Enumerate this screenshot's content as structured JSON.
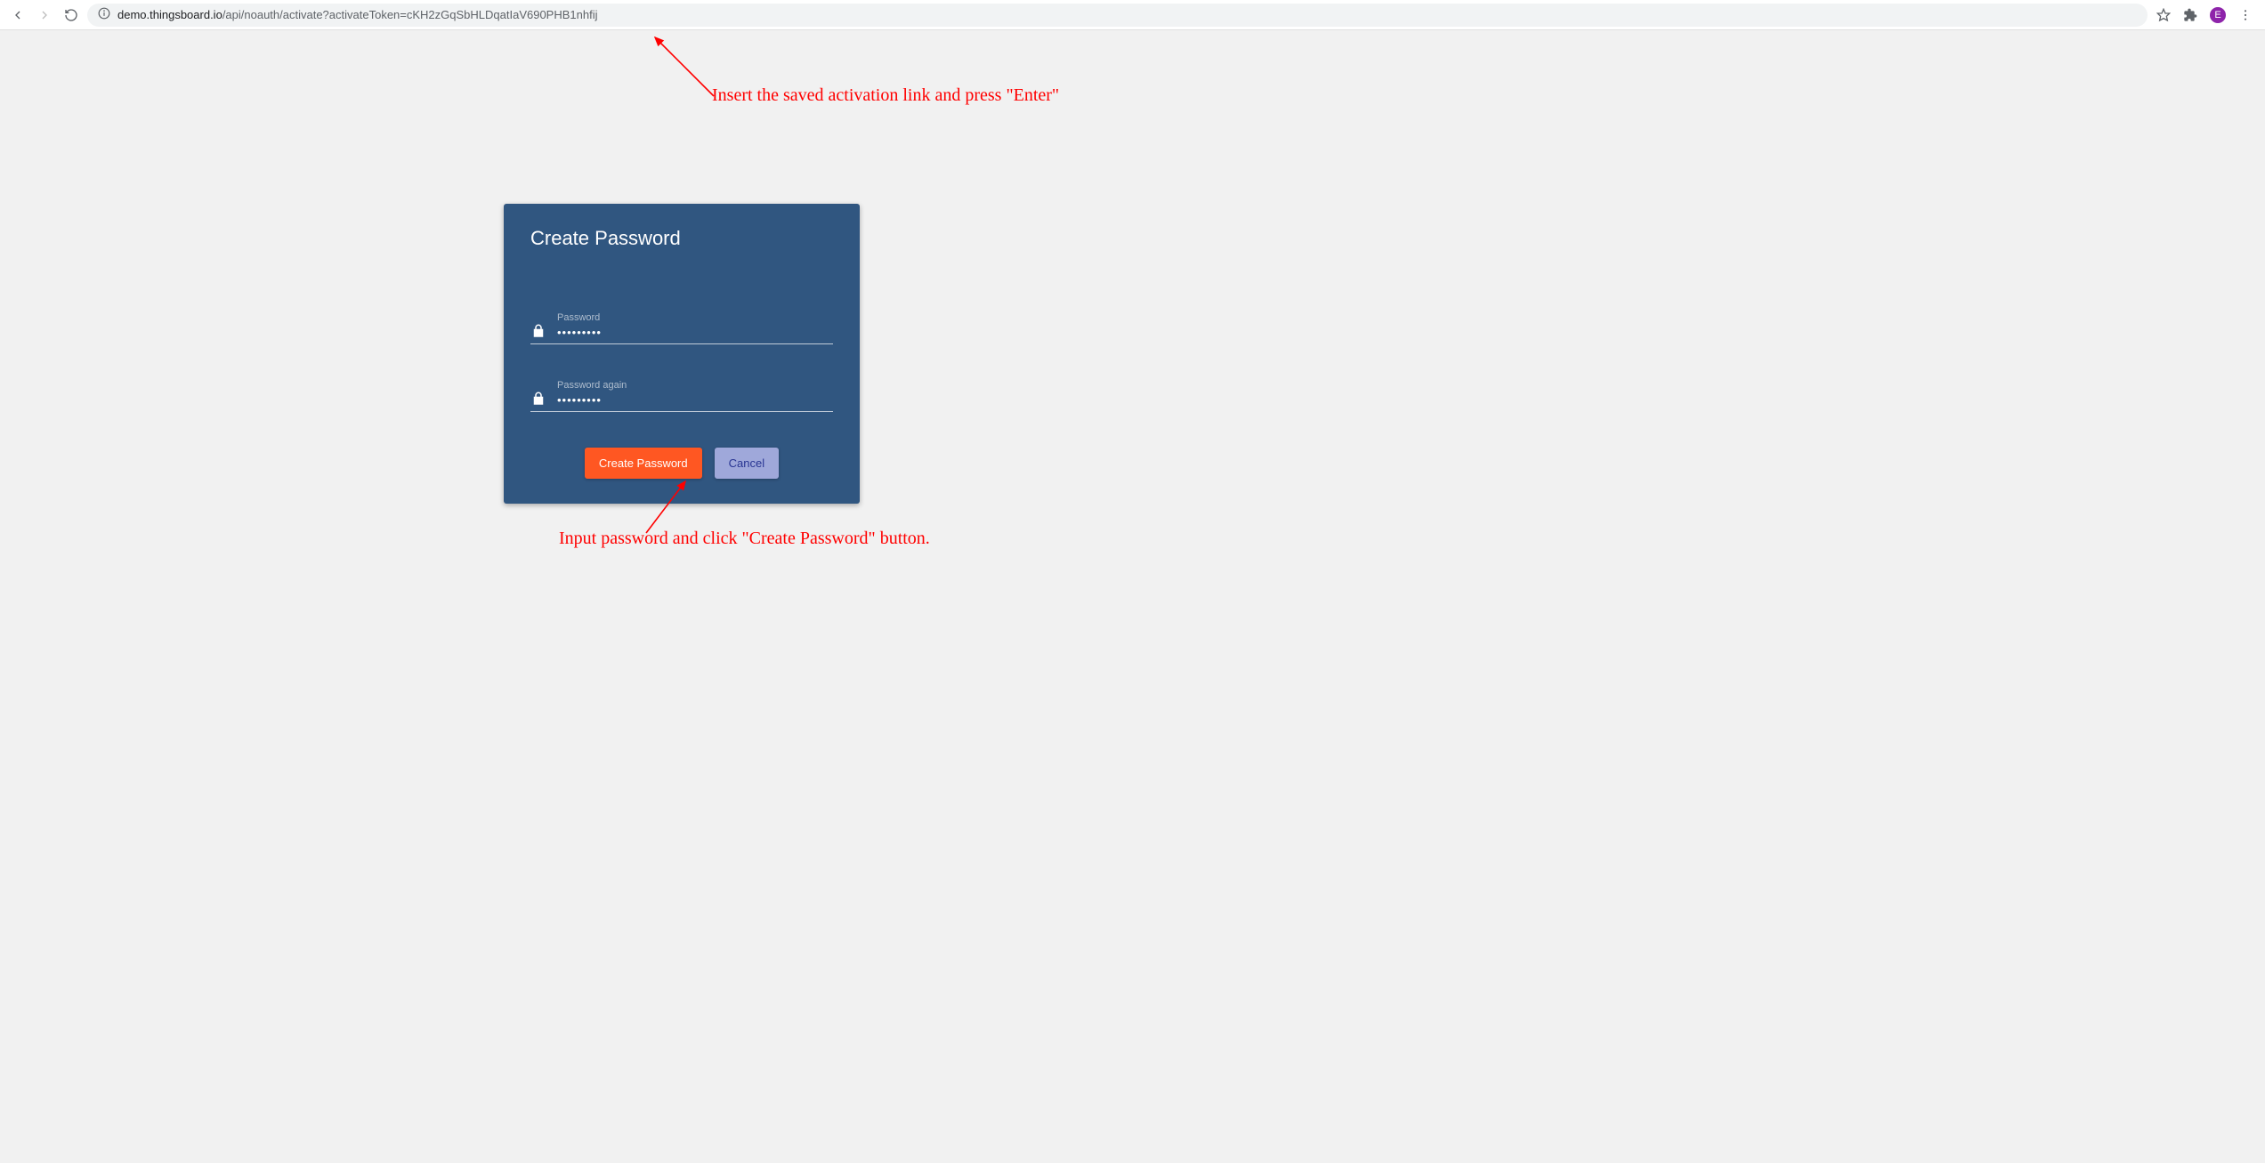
{
  "browser": {
    "url_host": "demo.thingsboard.io",
    "url_path": "/api/noauth/activate?activateToken=cKH2zGqSbHLDqatIaV690PHB1nhfij",
    "profile_initial": "E"
  },
  "card": {
    "title": "Create Password",
    "password_label": "Password",
    "password_value": "•••••••••",
    "password_again_label": "Password again",
    "password_again_value": "•••••••••",
    "create_button_label": "Create Password",
    "cancel_button_label": "Cancel"
  },
  "annotations": {
    "top": "Insert the saved activation link and press \"Enter\"",
    "bottom": "Input password and click \"Create Password\" button."
  }
}
